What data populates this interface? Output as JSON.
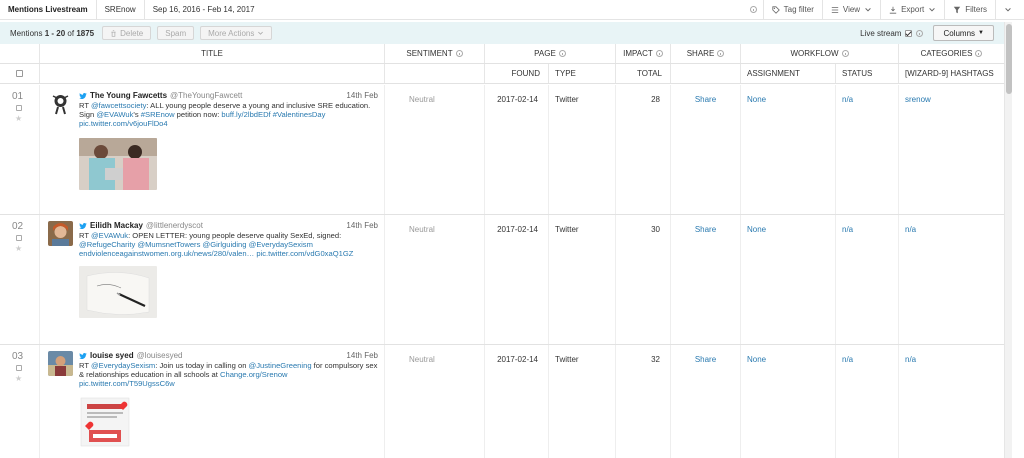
{
  "topbar": {
    "title": "Mentions Livestream",
    "project": "SREnow",
    "date_range": "Sep 16, 2016 - Feb 14, 2017",
    "tag_filter": "Tag filter",
    "view": "View",
    "export": "Export",
    "filters": "Filters"
  },
  "toolbar": {
    "count_prefix": "Mentions",
    "count_range": "1 - 20",
    "count_of": "of",
    "count_total": "1875",
    "delete": "Delete",
    "spam": "Spam",
    "more_actions": "More Actions",
    "live_stream": "Live stream",
    "live_stream_checked": true,
    "columns": "Columns"
  },
  "headers": {
    "title": "TITLE",
    "sentiment": "SENTIMENT",
    "page": "PAGE",
    "impact": "IMPACT",
    "share": "SHARE",
    "workflow": "WORKFLOW",
    "categories": "CATEGORIES",
    "found": "FOUND",
    "type": "TYPE",
    "total": "TOTAL",
    "assignment": "ASSIGNMENT",
    "status": "STATUS",
    "hashtags": "[WIZARD-9] HASHTAGS"
  },
  "rows": [
    {
      "num": "01",
      "name": "The Young Fawcetts",
      "handle": "@TheYoungFawcett",
      "date": "14th Feb",
      "text_parts": [
        {
          "t": "RT ",
          "link": false
        },
        {
          "t": "@fawcettsociety",
          "link": true
        },
        {
          "t": ": ALL young people deserve a young and inclusive SRE education. Sign ",
          "link": false
        },
        {
          "t": "@EVAWuk",
          "link": true
        },
        {
          "t": "'s ",
          "link": false
        },
        {
          "t": "#SREnow",
          "link": true
        },
        {
          "t": " petition now: ",
          "link": false
        },
        {
          "t": "buff.ly/2lbdEDf",
          "link": true
        },
        {
          "t": " ",
          "link": false
        },
        {
          "t": "#ValentinesDay",
          "link": true
        },
        {
          "t": " ",
          "link": false
        },
        {
          "t": "pic.twitter.com/v6jouFlDo4",
          "link": true
        }
      ],
      "sentiment": "Neutral",
      "found": "2017-02-14",
      "type": "Twitter",
      "impact": "28",
      "share": "Share",
      "assignment": "None",
      "status": "n/a",
      "hashtags": "srenow"
    },
    {
      "num": "02",
      "name": "Eilidh Mackay",
      "handle": "@littlenerdyscot",
      "date": "14th Feb",
      "text_parts": [
        {
          "t": "RT ",
          "link": false
        },
        {
          "t": "@EVAWuk",
          "link": true
        },
        {
          "t": ": OPEN LETTER: young people deserve quality SexEd, signed: ",
          "link": false
        },
        {
          "t": "@RefugeCharity",
          "link": true
        },
        {
          "t": " ",
          "link": false
        },
        {
          "t": "@MumsnetTowers",
          "link": true
        },
        {
          "t": " ",
          "link": false
        },
        {
          "t": "@Girlguiding",
          "link": true
        },
        {
          "t": " ",
          "link": false
        },
        {
          "t": "@EverydaySexism",
          "link": true
        },
        {
          "t": " ",
          "link": false
        },
        {
          "t": "endviolenceagainstwomen.org.uk/news/280/valen…",
          "link": true
        },
        {
          "t": " ",
          "link": false
        },
        {
          "t": "pic.twitter.com/vdG0xaQ1GZ",
          "link": true
        }
      ],
      "sentiment": "Neutral",
      "found": "2017-02-14",
      "type": "Twitter",
      "impact": "30",
      "share": "Share",
      "assignment": "None",
      "status": "n/a",
      "hashtags": "n/a"
    },
    {
      "num": "03",
      "name": "louise syed",
      "handle": "@louisesyed",
      "date": "14th Feb",
      "text_parts": [
        {
          "t": "RT ",
          "link": false
        },
        {
          "t": "@EverydaySexism",
          "link": true
        },
        {
          "t": ": Join us today in calling on ",
          "link": false
        },
        {
          "t": "@JustineGreening",
          "link": true
        },
        {
          "t": " for compulsory sex & relationships education in all schools at ",
          "link": false
        },
        {
          "t": "Change.org/Srenow",
          "link": true
        },
        {
          "t": " ",
          "link": false
        },
        {
          "t": "pic.twitter.com/T59UgssC6w",
          "link": true
        }
      ],
      "sentiment": "Neutral",
      "found": "2017-02-14",
      "type": "Twitter",
      "impact": "32",
      "share": "Share",
      "assignment": "None",
      "status": "n/a",
      "hashtags": "n/a"
    }
  ],
  "colors": {
    "link": "#2a7ab0",
    "toolbar_bg": "#e8f4f6",
    "twitter_blue": "#1da1f2"
  }
}
